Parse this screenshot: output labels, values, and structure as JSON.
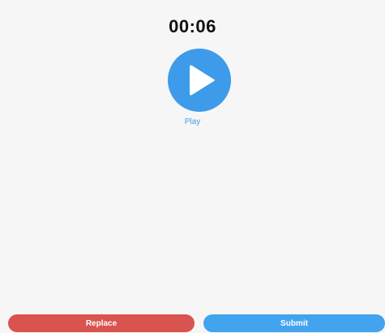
{
  "timer": {
    "elapsed": "00:06"
  },
  "player": {
    "play_label": "Play",
    "icon": "play-icon"
  },
  "actions": {
    "replace_label": "Replace",
    "submit_label": "Submit"
  },
  "colors": {
    "background": "#f6f6f7",
    "play_blue": "#3d9be9",
    "replace_red": "#d9534f",
    "submit_blue": "#42a3ee"
  }
}
